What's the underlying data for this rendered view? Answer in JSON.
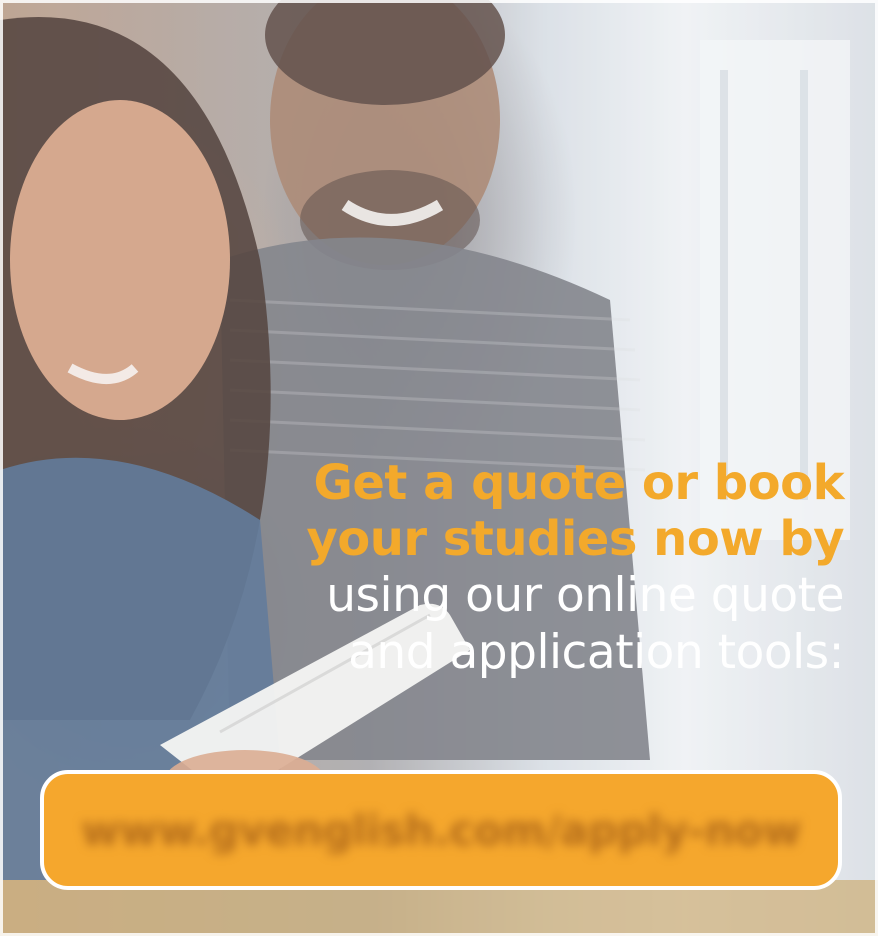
{
  "headline": {
    "lead_line_1": "Get a quote or book",
    "lead_line_2": "your studies now by",
    "body_line_1": "using our online quote",
    "body_line_2": "and application tools:"
  },
  "cta": {
    "url_text": "www.gvenglish.com/apply-now"
  },
  "colors": {
    "accent": "#f3a92b",
    "button_fill": "#f5a72d",
    "text_light": "#ffffff"
  }
}
